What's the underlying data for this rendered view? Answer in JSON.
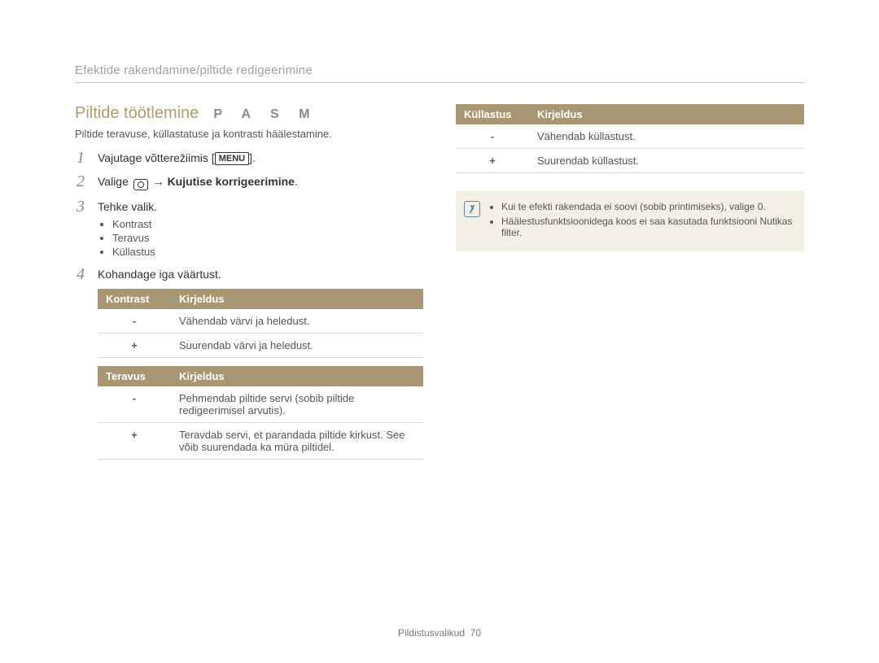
{
  "breadcrumb": "Efektide rakendamine/piltide redigeerimine",
  "title": "Piltide töötlemine",
  "mode_letters": "P A S M",
  "subtitle": "Piltide teravuse, küllastatuse ja kontrasti häälestamine.",
  "steps": {
    "s1_prefix": "Vajutage võtterežiimis [",
    "s1_menu": "MENU",
    "s1_suffix": "].",
    "s2_prefix": "Valige ",
    "s2_arrow": " → ",
    "s2_bold": "Kujutise korrigeerimine",
    "s2_suffix": ".",
    "s3": "Tehke valik.",
    "s3_items": {
      "a": "Kontrast",
      "b": "Teravus",
      "c": "Küllastus"
    },
    "s4": "Kohandage iga väärtust."
  },
  "tables": {
    "kontrast": {
      "h1": "Kontrast",
      "h2": "Kirjeldus",
      "rows": [
        {
          "k": "-",
          "v": "Vähendab värvi ja heledust."
        },
        {
          "k": "+",
          "v": "Suurendab värvi ja heledust."
        }
      ]
    },
    "teravus": {
      "h1": "Teravus",
      "h2": "Kirjeldus",
      "rows": [
        {
          "k": "-",
          "v": "Pehmendab piltide servi (sobib piltide redigeerimisel arvutis)."
        },
        {
          "k": "+",
          "v": "Teravdab servi, et parandada piltide kirkust. See võib suurendada ka müra piltidel."
        }
      ]
    },
    "kyllastus": {
      "h1": "Küllastus",
      "h2": "Kirjeldus",
      "rows": [
        {
          "k": "-",
          "v": "Vähendab küllastust."
        },
        {
          "k": "+",
          "v": "Suurendab küllastust."
        }
      ]
    }
  },
  "note": {
    "a": "Kui te efekti rakendada ei soovi (sobib printimiseks), valige 0.",
    "b": "Häälestusfunktsioonidega koos ei saa kasutada funktsiooni Nutikas filter."
  },
  "footer": {
    "section": "Pildistusvalikud",
    "page": "70"
  }
}
